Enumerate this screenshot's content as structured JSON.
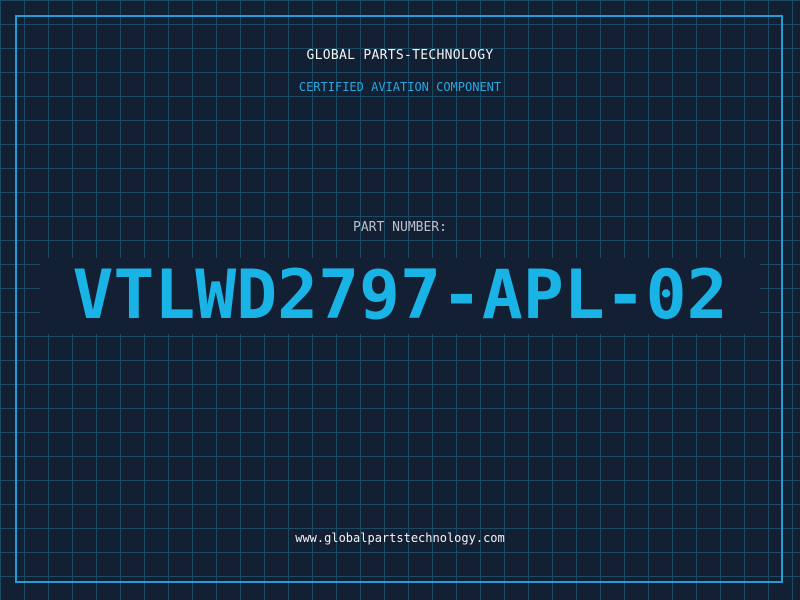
{
  "header": {
    "company": "GLOBAL PARTS-TECHNOLOGY",
    "tagline": "CERTIFIED AVIATION COMPONENT"
  },
  "part": {
    "label": "PART NUMBER:",
    "number": "VTLWD2797-APL-02"
  },
  "footer": {
    "website": "www.globalpartstechnology.com"
  },
  "colors": {
    "background": "#131f33",
    "grid": "#1d4a63",
    "accent": "#1ab3e6",
    "frame": "#1f9fd4",
    "text": "#f2f4f6"
  }
}
